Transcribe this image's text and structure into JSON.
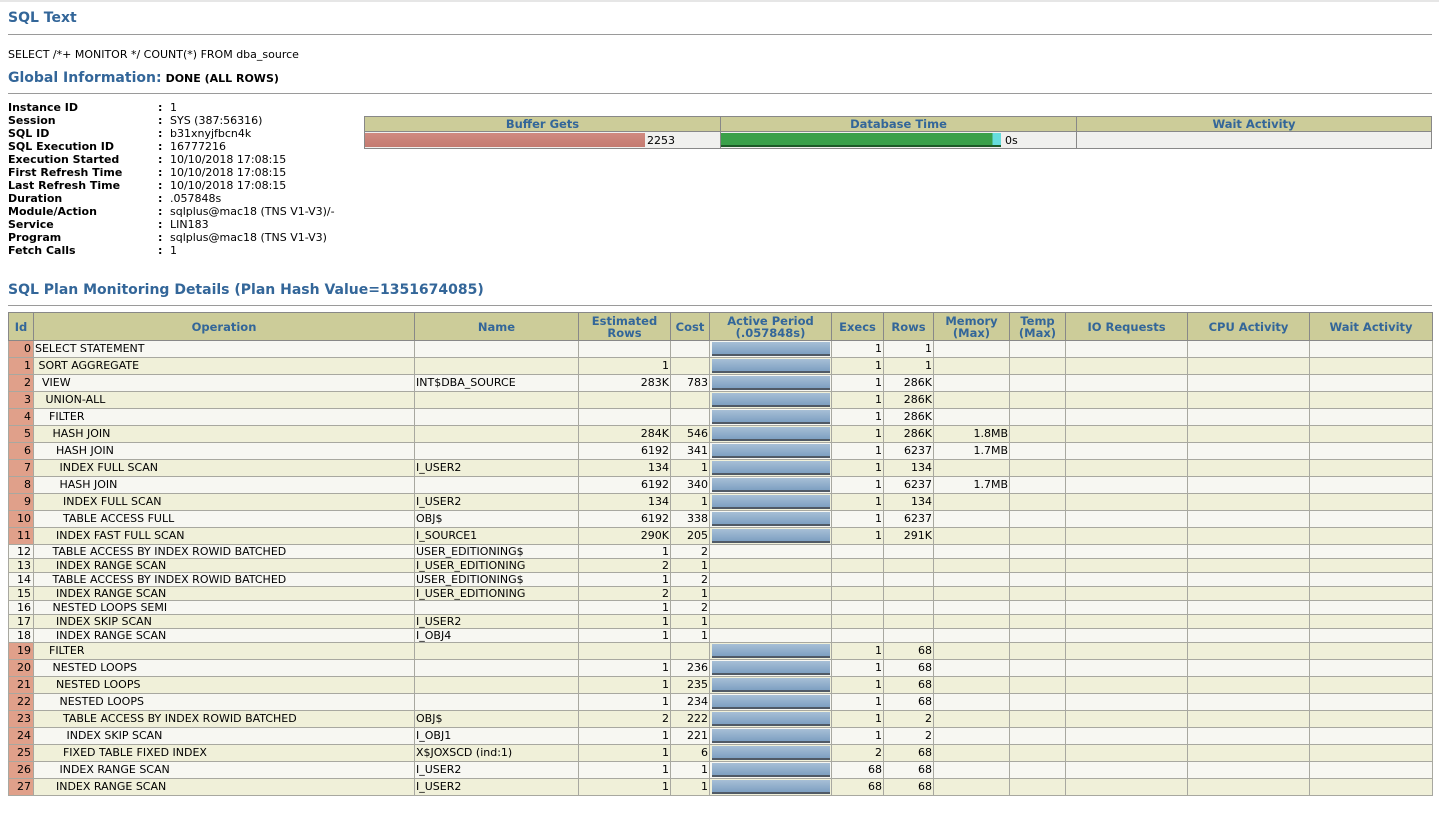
{
  "sql_text_section": {
    "title": "SQL Text",
    "text": "SELECT /*+ MONITOR */ COUNT(*) FROM dba_source"
  },
  "global_info": {
    "title": "Global Information:",
    "status": "DONE (ALL ROWS)",
    "fields": [
      {
        "key": "Instance ID",
        "value": "1"
      },
      {
        "key": "Session",
        "value": "SYS (387:56316)"
      },
      {
        "key": "SQL ID",
        "value": "b31xnyjfbcn4k"
      },
      {
        "key": "SQL Execution ID",
        "value": "16777216"
      },
      {
        "key": "Execution Started",
        "value": "10/10/2018 17:08:15"
      },
      {
        "key": "First Refresh Time",
        "value": "10/10/2018 17:08:15"
      },
      {
        "key": "Last Refresh Time",
        "value": "10/10/2018 17:08:15"
      },
      {
        "key": "Duration",
        "value": ".057848s"
      },
      {
        "key": "Module/Action",
        "value": "sqlplus@mac18 (TNS V1-V3)/-"
      },
      {
        "key": "Service",
        "value": "LIN183"
      },
      {
        "key": "Program",
        "value": "sqlplus@mac18 (TNS V1-V3)"
      },
      {
        "key": "Fetch Calls",
        "value": "1"
      }
    ],
    "colon": ":"
  },
  "stats": {
    "headers": [
      "Buffer Gets",
      "Database Time",
      "Wait Activity"
    ],
    "buffer_gets_value": "2253",
    "database_time_value": "0s",
    "buffer_gets_fill": 1.0,
    "database_time_fill": 1.0,
    "colors": {
      "buffer_gets": "#d08a80",
      "database_time": "#3aa04a",
      "database_time_tip": "#66dddd"
    }
  },
  "plan_section": {
    "title": "SQL Plan Monitoring Details (Plan Hash Value=1351674085)",
    "headers": [
      "Id",
      "Operation",
      "Name",
      "Estimated Rows",
      "Cost",
      "Active Period (.057848s)",
      "Execs",
      "Rows",
      "Memory (Max)",
      "Temp (Max)",
      "IO Requests",
      "CPU Activity",
      "Wait Activity"
    ],
    "rows": [
      {
        "id": "0",
        "op": "SELECT STATEMENT",
        "name": "",
        "est": "",
        "cost": "",
        "active": true,
        "execs": "1",
        "rows": "1",
        "mem": ""
      },
      {
        "id": "1",
        "op": " SORT AGGREGATE",
        "name": "",
        "est": "1",
        "cost": "",
        "active": true,
        "execs": "1",
        "rows": "1",
        "mem": ""
      },
      {
        "id": "2",
        "op": "  VIEW",
        "name": "INT$DBA_SOURCE",
        "est": "283K",
        "cost": "783",
        "active": true,
        "execs": "1",
        "rows": "286K",
        "mem": ""
      },
      {
        "id": "3",
        "op": "   UNION-ALL",
        "name": "",
        "est": "",
        "cost": "",
        "active": true,
        "execs": "1",
        "rows": "286K",
        "mem": ""
      },
      {
        "id": "4",
        "op": "    FILTER",
        "name": "",
        "est": "",
        "cost": "",
        "active": true,
        "execs": "1",
        "rows": "286K",
        "mem": ""
      },
      {
        "id": "5",
        "op": "     HASH JOIN",
        "name": "",
        "est": "284K",
        "cost": "546",
        "active": true,
        "execs": "1",
        "rows": "286K",
        "mem": "1.8MB"
      },
      {
        "id": "6",
        "op": "      HASH JOIN",
        "name": "",
        "est": "6192",
        "cost": "341",
        "active": true,
        "execs": "1",
        "rows": "6237",
        "mem": "1.7MB"
      },
      {
        "id": "7",
        "op": "       INDEX FULL SCAN",
        "name": "I_USER2",
        "est": "134",
        "cost": "1",
        "active": true,
        "execs": "1",
        "rows": "134",
        "mem": ""
      },
      {
        "id": "8",
        "op": "       HASH JOIN",
        "name": "",
        "est": "6192",
        "cost": "340",
        "active": true,
        "execs": "1",
        "rows": "6237",
        "mem": "1.7MB"
      },
      {
        "id": "9",
        "op": "        INDEX FULL SCAN",
        "name": "I_USER2",
        "est": "134",
        "cost": "1",
        "active": true,
        "execs": "1",
        "rows": "134",
        "mem": ""
      },
      {
        "id": "10",
        "op": "        TABLE ACCESS FULL",
        "name": "OBJ$",
        "est": "6192",
        "cost": "338",
        "active": true,
        "execs": "1",
        "rows": "6237",
        "mem": ""
      },
      {
        "id": "11",
        "op": "      INDEX FAST FULL SCAN",
        "name": "I_SOURCE1",
        "est": "290K",
        "cost": "205",
        "active": true,
        "execs": "1",
        "rows": "291K",
        "mem": ""
      },
      {
        "id": "12",
        "op": "     TABLE ACCESS BY INDEX ROWID BATCHED",
        "name": "USER_EDITIONING$",
        "est": "1",
        "cost": "2",
        "active": false,
        "execs": "",
        "rows": "",
        "mem": ""
      },
      {
        "id": "13",
        "op": "      INDEX RANGE SCAN",
        "name": "I_USER_EDITIONING",
        "est": "2",
        "cost": "1",
        "active": false,
        "execs": "",
        "rows": "",
        "mem": ""
      },
      {
        "id": "14",
        "op": "     TABLE ACCESS BY INDEX ROWID BATCHED",
        "name": "USER_EDITIONING$",
        "est": "1",
        "cost": "2",
        "active": false,
        "execs": "",
        "rows": "",
        "mem": ""
      },
      {
        "id": "15",
        "op": "      INDEX RANGE SCAN",
        "name": "I_USER_EDITIONING",
        "est": "2",
        "cost": "1",
        "active": false,
        "execs": "",
        "rows": "",
        "mem": ""
      },
      {
        "id": "16",
        "op": "     NESTED LOOPS SEMI",
        "name": "",
        "est": "1",
        "cost": "2",
        "active": false,
        "execs": "",
        "rows": "",
        "mem": ""
      },
      {
        "id": "17",
        "op": "      INDEX SKIP SCAN",
        "name": "I_USER2",
        "est": "1",
        "cost": "1",
        "active": false,
        "execs": "",
        "rows": "",
        "mem": ""
      },
      {
        "id": "18",
        "op": "      INDEX RANGE SCAN",
        "name": "I_OBJ4",
        "est": "1",
        "cost": "1",
        "active": false,
        "execs": "",
        "rows": "",
        "mem": ""
      },
      {
        "id": "19",
        "op": "    FILTER",
        "name": "",
        "est": "",
        "cost": "",
        "active": true,
        "execs": "1",
        "rows": "68",
        "mem": ""
      },
      {
        "id": "20",
        "op": "     NESTED LOOPS",
        "name": "",
        "est": "1",
        "cost": "236",
        "active": true,
        "execs": "1",
        "rows": "68",
        "mem": ""
      },
      {
        "id": "21",
        "op": "      NESTED LOOPS",
        "name": "",
        "est": "1",
        "cost": "235",
        "active": true,
        "execs": "1",
        "rows": "68",
        "mem": ""
      },
      {
        "id": "22",
        "op": "       NESTED LOOPS",
        "name": "",
        "est": "1",
        "cost": "234",
        "active": true,
        "execs": "1",
        "rows": "68",
        "mem": ""
      },
      {
        "id": "23",
        "op": "        TABLE ACCESS BY INDEX ROWID BATCHED",
        "name": "OBJ$",
        "est": "2",
        "cost": "222",
        "active": true,
        "execs": "1",
        "rows": "2",
        "mem": ""
      },
      {
        "id": "24",
        "op": "         INDEX SKIP SCAN",
        "name": "I_OBJ1",
        "est": "1",
        "cost": "221",
        "active": true,
        "execs": "1",
        "rows": "2",
        "mem": ""
      },
      {
        "id": "25",
        "op": "        FIXED TABLE FIXED INDEX",
        "name": "X$JOXSCD (ind:1)",
        "est": "1",
        "cost": "6",
        "active": true,
        "execs": "2",
        "rows": "68",
        "mem": ""
      },
      {
        "id": "26",
        "op": "       INDEX RANGE SCAN",
        "name": "I_USER2",
        "est": "1",
        "cost": "1",
        "active": true,
        "execs": "68",
        "rows": "68",
        "mem": ""
      },
      {
        "id": "27",
        "op": "      INDEX RANGE SCAN",
        "name": "I_USER2",
        "est": "1",
        "cost": "1",
        "active": true,
        "execs": "68",
        "rows": "68",
        "mem": ""
      }
    ]
  }
}
